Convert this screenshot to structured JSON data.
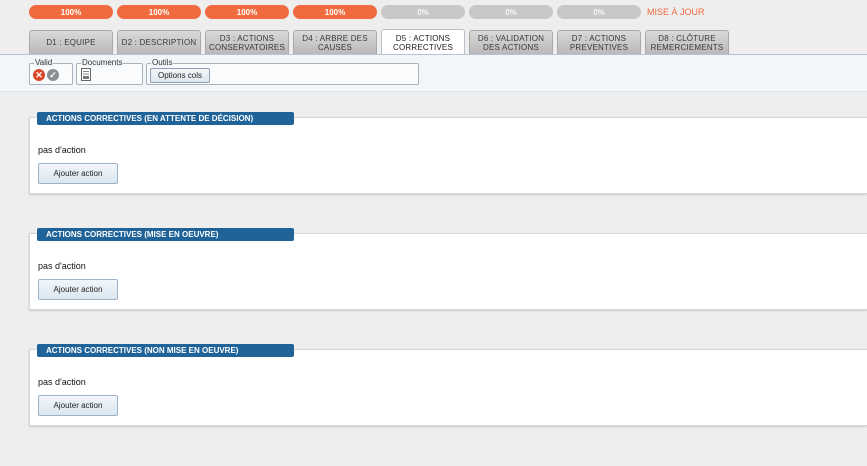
{
  "progress": [
    {
      "label": "100%",
      "state": "done"
    },
    {
      "label": "100%",
      "state": "done"
    },
    {
      "label": "100%",
      "state": "done"
    },
    {
      "label": "100%",
      "state": "done"
    },
    {
      "label": "0%",
      "state": "todo"
    },
    {
      "label": "0%",
      "state": "todo"
    },
    {
      "label": "0%",
      "state": "todo"
    }
  ],
  "update_link": "MISE À JOUR",
  "tabs": [
    {
      "lines": [
        "D1 : EQUIPE"
      ],
      "active": false
    },
    {
      "lines": [
        "D2 : DESCRIPTION"
      ],
      "active": false
    },
    {
      "lines": [
        "D3 : ACTIONS",
        "CONSERVATOIRES"
      ],
      "active": false
    },
    {
      "lines": [
        "D4 : ARBRE DES",
        "CAUSES"
      ],
      "active": false
    },
    {
      "lines": [
        "D5 : ACTIONS",
        "CORRECTIVES"
      ],
      "active": true
    },
    {
      "lines": [
        "D6 : VALIDATION",
        "DES ACTIONS"
      ],
      "active": false
    },
    {
      "lines": [
        "D7 : ACTIONS",
        "PREVENTIVES"
      ],
      "active": false
    },
    {
      "lines": [
        "D8 : CLÔTURE",
        "REMERCIEMENTS"
      ],
      "active": false
    }
  ],
  "toolbar": {
    "valid_legend": "Valid",
    "documents_legend": "Documents",
    "outils_legend": "Outils",
    "options_button": "Options cols"
  },
  "panels": [
    {
      "title": "ACTIONS CORRECTIVES (EN ATTENTE DE DÉCISION)",
      "empty_text": "pas d'action",
      "button": "Ajouter action"
    },
    {
      "title": "ACTIONS CORRECTIVES (MISE EN OEUVRE)",
      "empty_text": "pas d'action",
      "button": "Ajouter action"
    },
    {
      "title": "ACTIONS CORRECTIVES (NON MISE EN OEUVRE)",
      "empty_text": "pas d'action",
      "button": "Ajouter action"
    }
  ],
  "colors": {
    "accent": "#f26a3f",
    "header": "#1f6399",
    "reject": "#d9482b",
    "approve": "#8a8f94"
  }
}
